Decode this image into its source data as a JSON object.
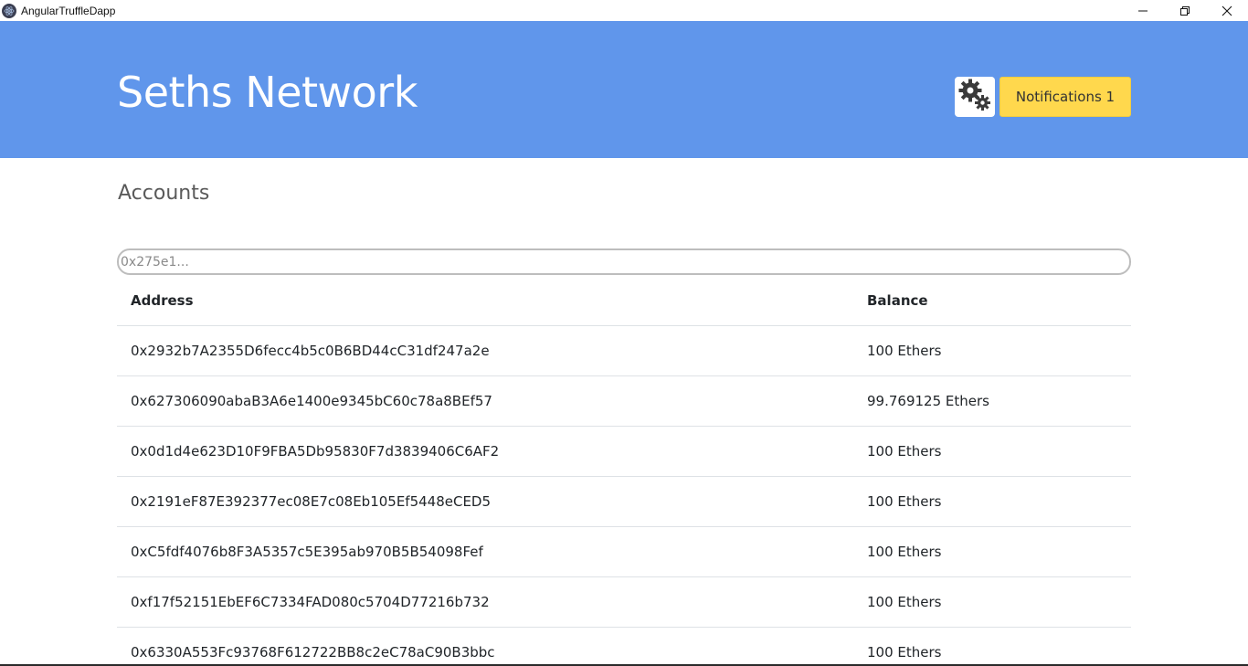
{
  "window": {
    "title": "AngularTruffleDapp",
    "icon": "electron-icon",
    "controls": [
      "minimize-icon",
      "restore-icon",
      "close-icon"
    ]
  },
  "header": {
    "brand": "Seths Network",
    "settings_icon": "gears-icon",
    "notifications_label": "Notifications 1",
    "colors": {
      "band": "#6096eb",
      "notifications": "#ffd84d"
    }
  },
  "main": {
    "title": "Accounts",
    "search": {
      "placeholder": "0x275e1...",
      "value": ""
    },
    "table": {
      "columns": [
        "Address",
        "Balance"
      ],
      "rows": [
        {
          "address": "0x2932b7A2355D6fecc4b5c0B6BD44cC31df247a2e",
          "balance": "100 Ethers"
        },
        {
          "address": "0x627306090abaB3A6e1400e9345bC60c78a8BEf57",
          "balance": "99.769125 Ethers"
        },
        {
          "address": "0x0d1d4e623D10F9FBA5Db95830F7d3839406C6AF2",
          "balance": "100 Ethers"
        },
        {
          "address": "0x2191eF87E392377ec08E7c08Eb105Ef5448eCED5",
          "balance": "100 Ethers"
        },
        {
          "address": "0xC5fdf4076b8F3A5357c5E395ab970B5B54098Fef",
          "balance": "100 Ethers"
        },
        {
          "address": "0xf17f52151EbEF6C7334FAD080c5704D77216b732",
          "balance": "100 Ethers"
        },
        {
          "address": "0x6330A553Fc93768F612722BB8c2eC78aC90B3bbc",
          "balance": "100 Ethers"
        }
      ]
    }
  }
}
